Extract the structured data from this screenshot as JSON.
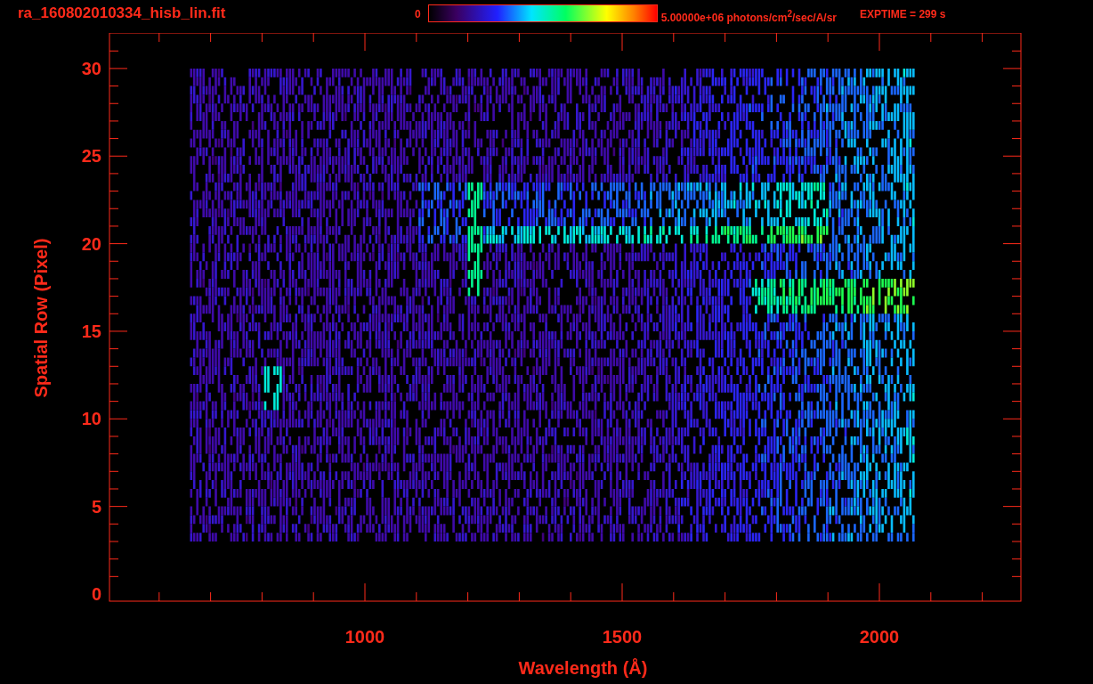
{
  "header": {
    "title": "ra_160802010334_hisb_lin.fit",
    "colorbar_min": "0",
    "colorbar_max": "5.00000e+06 photons/cm$^{2}$/sec/A/sr",
    "exposure": "EXPTIME = 299 s"
  },
  "plot": {
    "x_axis": {
      "label": "Wavelength (Å)",
      "ticks": [
        "1000",
        "1500",
        "2000"
      ]
    },
    "y_axis": {
      "label": "Spatial Row (Pixel)",
      "ticks": [
        "30",
        "25",
        "20",
        "15",
        "10",
        "5",
        "0"
      ]
    }
  }
}
